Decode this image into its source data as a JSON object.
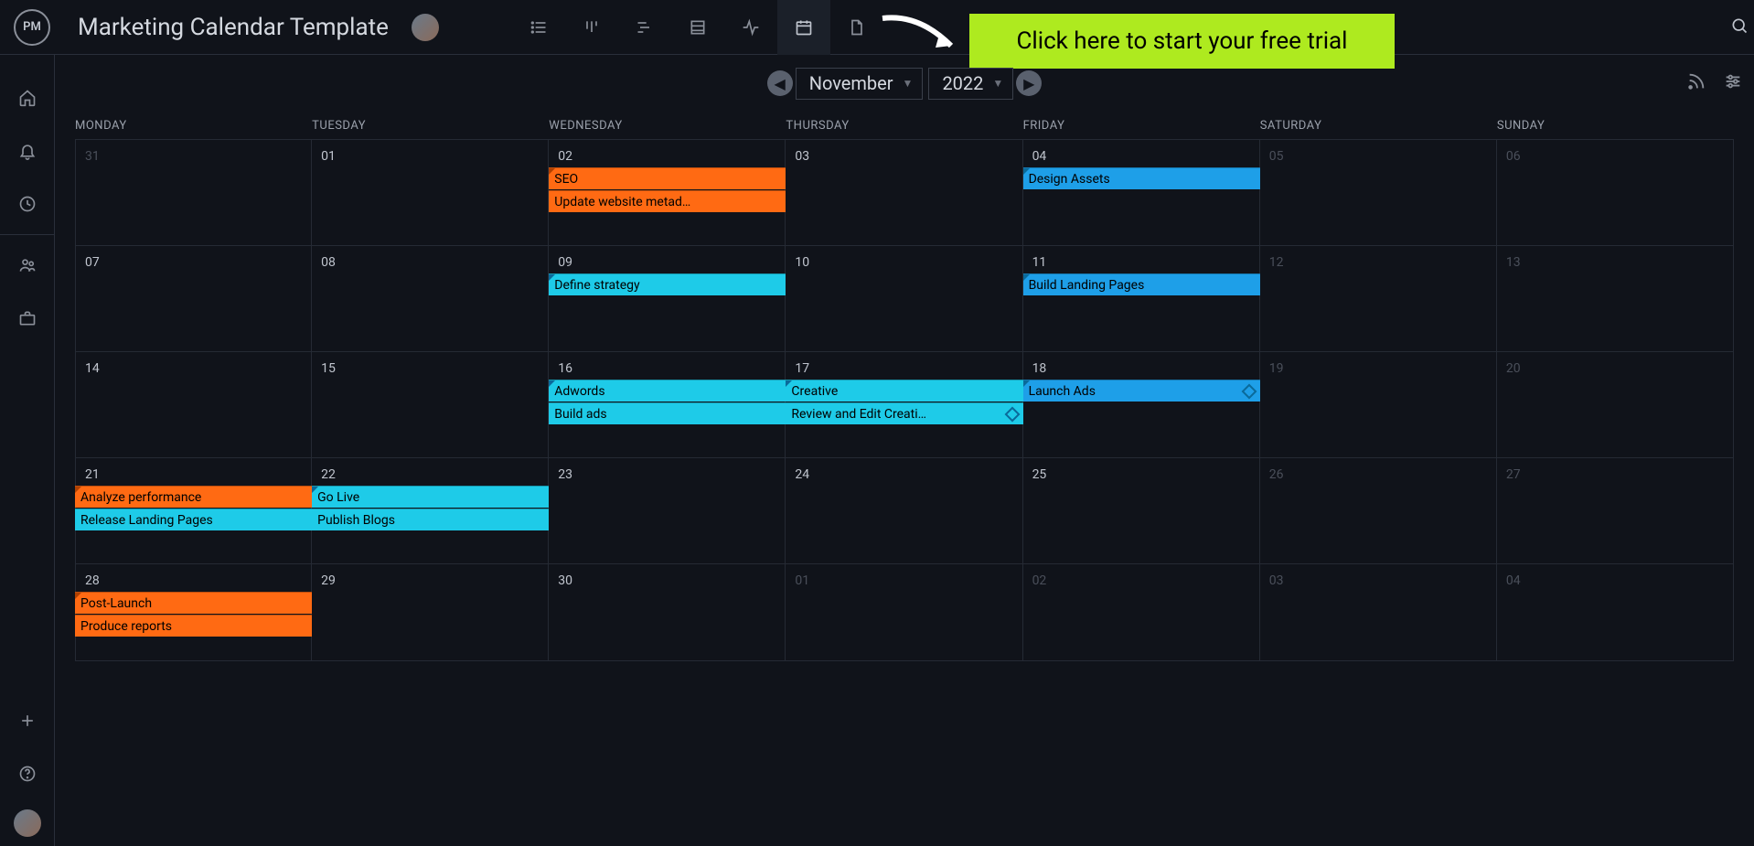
{
  "header": {
    "logo_text": "PM",
    "title": "Marketing Calendar Template"
  },
  "cta": {
    "label": "Click here to start your free trial"
  },
  "calendar": {
    "month": "November",
    "year": "2022",
    "day_headers": [
      "MONDAY",
      "TUESDAY",
      "WEDNESDAY",
      "THURSDAY",
      "FRIDAY",
      "SATURDAY",
      "SUNDAY"
    ],
    "cells": [
      [
        {
          "n": "31",
          "out": true
        },
        {
          "n": "01"
        },
        {
          "n": "02"
        },
        {
          "n": "03"
        },
        {
          "n": "04"
        },
        {
          "n": "05",
          "out": true
        },
        {
          "n": "06",
          "out": true
        }
      ],
      [
        {
          "n": "07"
        },
        {
          "n": "08"
        },
        {
          "n": "09"
        },
        {
          "n": "10"
        },
        {
          "n": "11"
        },
        {
          "n": "12",
          "out": true
        },
        {
          "n": "13",
          "out": true
        }
      ],
      [
        {
          "n": "14"
        },
        {
          "n": "15"
        },
        {
          "n": "16"
        },
        {
          "n": "17"
        },
        {
          "n": "18"
        },
        {
          "n": "19",
          "out": true
        },
        {
          "n": "20",
          "out": true
        }
      ],
      [
        {
          "n": "21"
        },
        {
          "n": "22"
        },
        {
          "n": "23"
        },
        {
          "n": "24"
        },
        {
          "n": "25"
        },
        {
          "n": "26",
          "out": true
        },
        {
          "n": "27",
          "out": true
        }
      ],
      [
        {
          "n": "28"
        },
        {
          "n": "29"
        },
        {
          "n": "30"
        },
        {
          "n": "01",
          "out": true
        },
        {
          "n": "02",
          "out": true
        },
        {
          "n": "03",
          "out": true
        },
        {
          "n": "04",
          "out": true
        }
      ]
    ],
    "events": [
      {
        "row": 0,
        "label": "SEO",
        "color": "orange",
        "start": 2,
        "span": 1,
        "slot": 0,
        "corner": true
      },
      {
        "row": 0,
        "label": "Update website metad…",
        "color": "orange",
        "start": 2,
        "span": 1,
        "slot": 1,
        "corner": false
      },
      {
        "row": 0,
        "label": "Design Assets",
        "color": "blue-dark",
        "start": 4,
        "span": 1,
        "slot": 0,
        "corner": true
      },
      {
        "row": 1,
        "label": "Define strategy",
        "color": "cyan",
        "start": 2,
        "span": 1,
        "slot": 0,
        "corner": true
      },
      {
        "row": 1,
        "label": "Build Landing Pages",
        "color": "blue-dark",
        "start": 4,
        "span": 1,
        "slot": 0,
        "corner": true
      },
      {
        "row": 2,
        "label": "Adwords",
        "color": "cyan",
        "start": 2,
        "span": 1,
        "slot": 0,
        "corner": true
      },
      {
        "row": 2,
        "label": "Build ads",
        "color": "cyan",
        "start": 2,
        "span": 1,
        "slot": 1,
        "corner": false
      },
      {
        "row": 2,
        "label": "Creative",
        "color": "cyan",
        "start": 3,
        "span": 1,
        "slot": 0,
        "corner": true
      },
      {
        "row": 2,
        "label": "Review and Edit Creati…",
        "color": "cyan",
        "start": 3,
        "span": 1,
        "slot": 1,
        "corner": false,
        "diamond": true
      },
      {
        "row": 2,
        "label": "Launch Ads",
        "color": "blue-dark",
        "start": 4,
        "span": 1,
        "slot": 0,
        "corner": true,
        "diamond": true
      },
      {
        "row": 3,
        "label": "Analyze performance",
        "color": "orange",
        "start": 0,
        "span": 1,
        "slot": 0,
        "corner": true
      },
      {
        "row": 3,
        "label": "Release Landing Pages",
        "color": "cyan",
        "start": 0,
        "span": 1,
        "slot": 1,
        "corner": false
      },
      {
        "row": 3,
        "label": "Go Live",
        "color": "cyan",
        "start": 1,
        "span": 1,
        "slot": 0,
        "corner": true
      },
      {
        "row": 3,
        "label": "Publish Blogs",
        "color": "cyan",
        "start": 1,
        "span": 1,
        "slot": 1,
        "corner": false
      },
      {
        "row": 4,
        "label": "Post-Launch",
        "color": "orange",
        "start": 0,
        "span": 1,
        "slot": 0,
        "corner": true
      },
      {
        "row": 4,
        "label": "Produce reports",
        "color": "orange",
        "start": 0,
        "span": 1,
        "slot": 1,
        "corner": false
      }
    ]
  }
}
